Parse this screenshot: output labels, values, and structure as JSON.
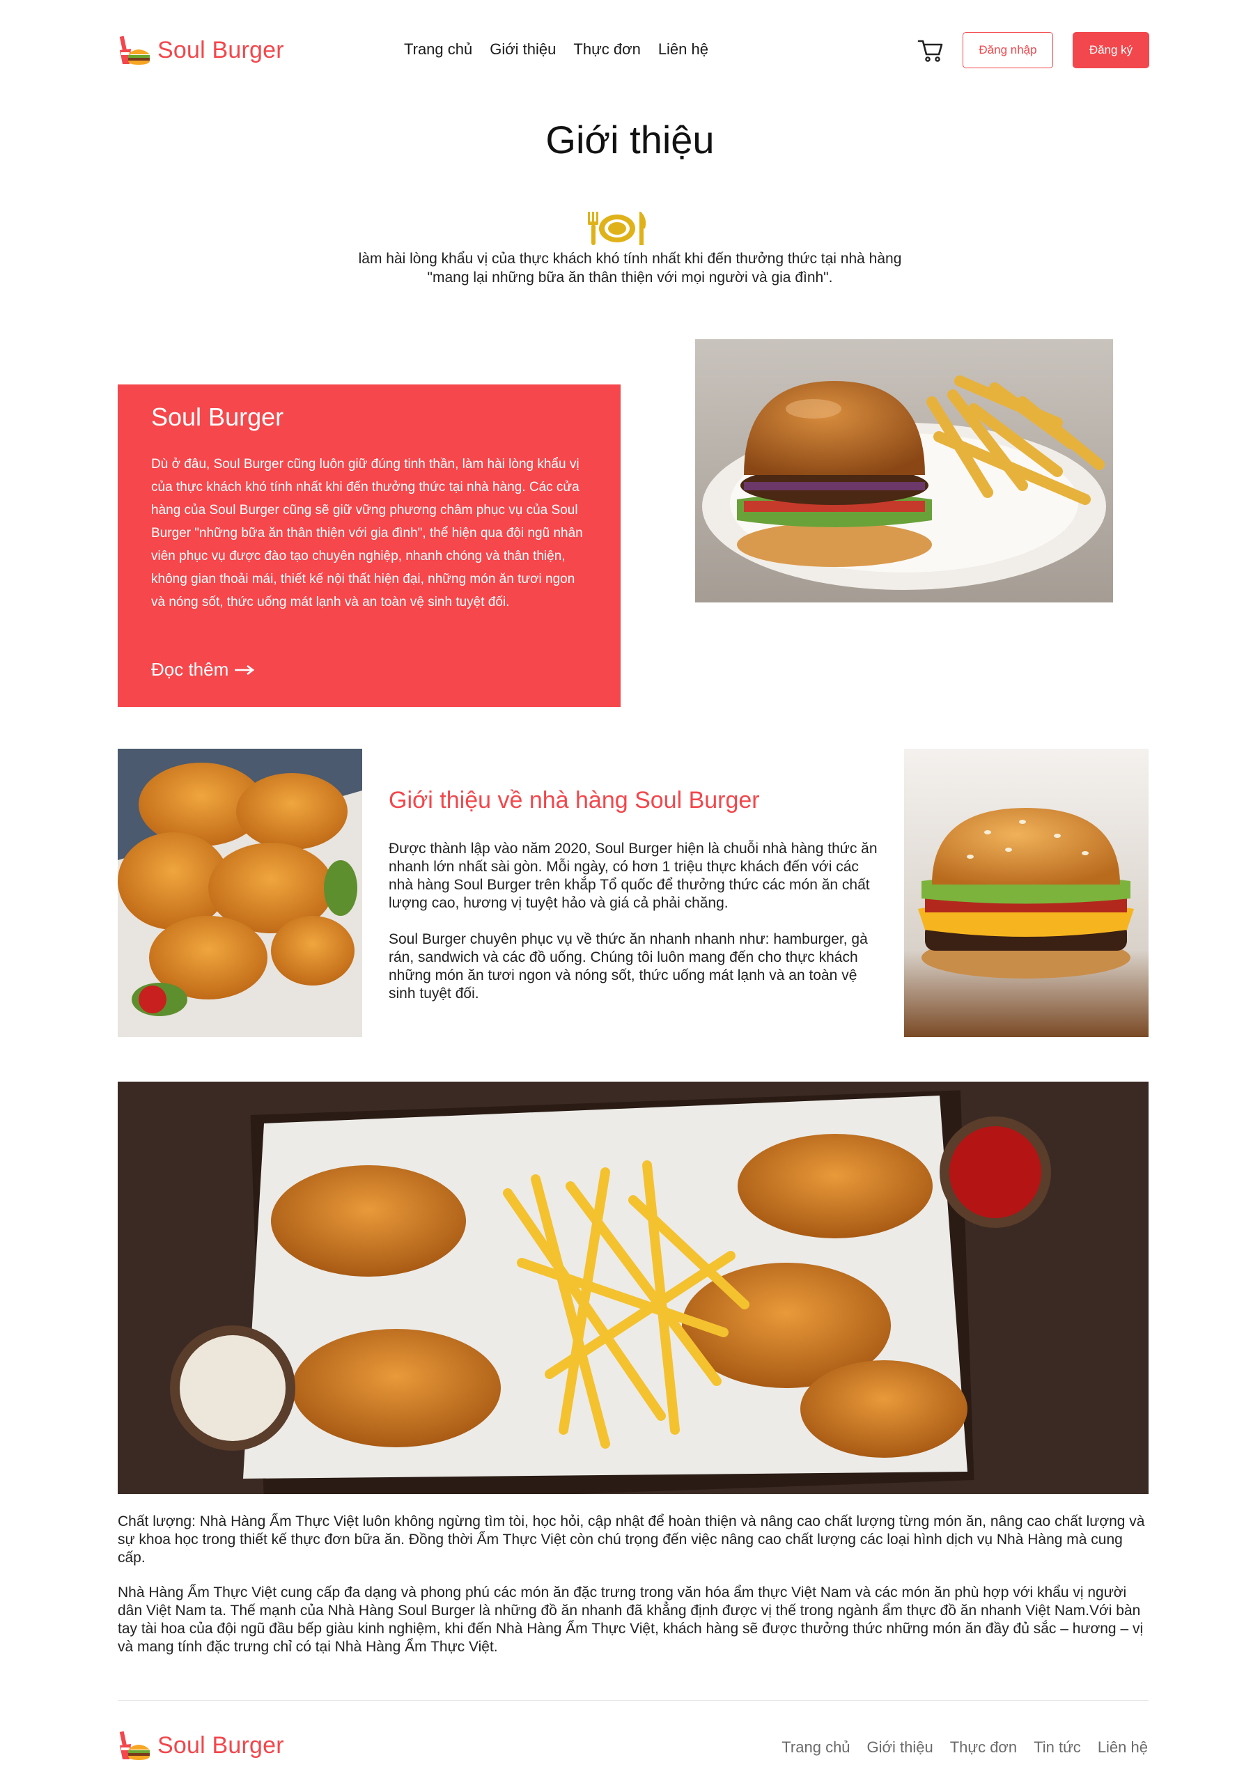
{
  "header": {
    "brand": "Soul Burger",
    "nav": [
      "Trang chủ",
      "Giới thiệu",
      "Thực đơn",
      "Liên hệ"
    ],
    "login_label": "Đăng nhập",
    "register_label": "Đăng ký"
  },
  "hero": {
    "title": "Giới thiệu",
    "intro_line1": "làm hài lòng khẩu vị của thực khách khó tính nhất khi đến thưởng thức tại nhà hàng",
    "intro_line2": "\"mang lại những bữa ăn thân thiện với mọi người và gia đình\"."
  },
  "card": {
    "title": "Soul Burger",
    "text": "Dù ở đâu, Soul Burger cũng luôn giữ đúng tinh thần, làm hài lòng khẩu vị của thực khách khó tính nhất khi đến thưởng thức tại nhà hàng. Các cửa hàng của Soul Burger cũng sẽ giữ vững phương châm phục vụ của Soul Burger \"những bữa ăn thân thiện với gia đình\", thể hiện qua đội ngũ nhân viên phục vụ được đào tạo chuyên nghiệp, nhanh chóng và thân thiện, không gian thoải mái, thiết kế nội thất hiện đại, những món ăn tươi ngon và nóng sốt, thức uống mát lạnh và an toàn vệ sinh tuyệt đối.",
    "read_more": "Đọc thêm"
  },
  "about": {
    "title": "Giới thiệu về nhà hàng Soul Burger",
    "p1": "Được thành lập vào năm 2020, Soul Burger hiện là chuỗi nhà hàng thức ăn nhanh lớn nhất sài gòn. Mỗi ngày, có hơn 1 triệu thực khách đến với các nhà hàng Soul Burger trên khắp Tổ quốc để thưởng thức các món ăn chất lượng cao, hương vị tuyệt hảo và giá cả phải chăng.",
    "p2": "Soul Burger chuyên phục vụ về thức ăn nhanh nhanh như: hamburger, gà rán, sandwich và các đồ uống. Chúng tôi luôn mang đến cho thực khách những món ăn tươi ngon và nóng sốt, thức uống mát lạnh và an toàn vệ sinh tuyệt đối."
  },
  "bottom": {
    "p1": "Chất lượng: Nhà Hàng Ẩm Thực Việt luôn không ngừng tìm tòi, học hỏi, cập nhật để hoàn thiện và nâng cao chất lượng từng món ăn, nâng cao chất lượng và sự khoa học trong thiết kế thực đơn bữa ăn. Đồng thời Ẩm Thực Việt còn chú trọng đến việc nâng cao chất lượng các loại hình dịch vụ Nhà Hàng mà cung cấp.",
    "p2": "Nhà Hàng Ẩm Thực Việt cung cấp đa dạng và phong phú các món ăn đặc trưng trong văn hóa ẩm thực Việt Nam và các món ăn phù hợp với khẩu vị người dân Việt Nam ta. Thế mạnh của Nhà Hàng Soul Burger là những đồ ăn nhanh đã khẳng định được vị thế trong ngành ẩm thực đồ ăn nhanh Việt Nam.Với bàn tay tài hoa của đội ngũ đầu bếp giàu kinh nghiệm, khi đến Nhà Hàng Ẩm Thực Việt, khách hàng sẽ được thưởng thức những món ăn đầy đủ sắc – hương – vị và mang tính đặc trưng chỉ có tại Nhà Hàng Ẩm Thực Việt."
  },
  "footer": {
    "brand": "Soul Burger",
    "nav": [
      "Trang chủ",
      "Giới thiệu",
      "Thực đơn",
      "Tin tức",
      "Liên hệ"
    ]
  },
  "colors": {
    "accent": "#f2474c",
    "card_bg": "#f5474c",
    "icon_gold": "#e0b21a"
  }
}
